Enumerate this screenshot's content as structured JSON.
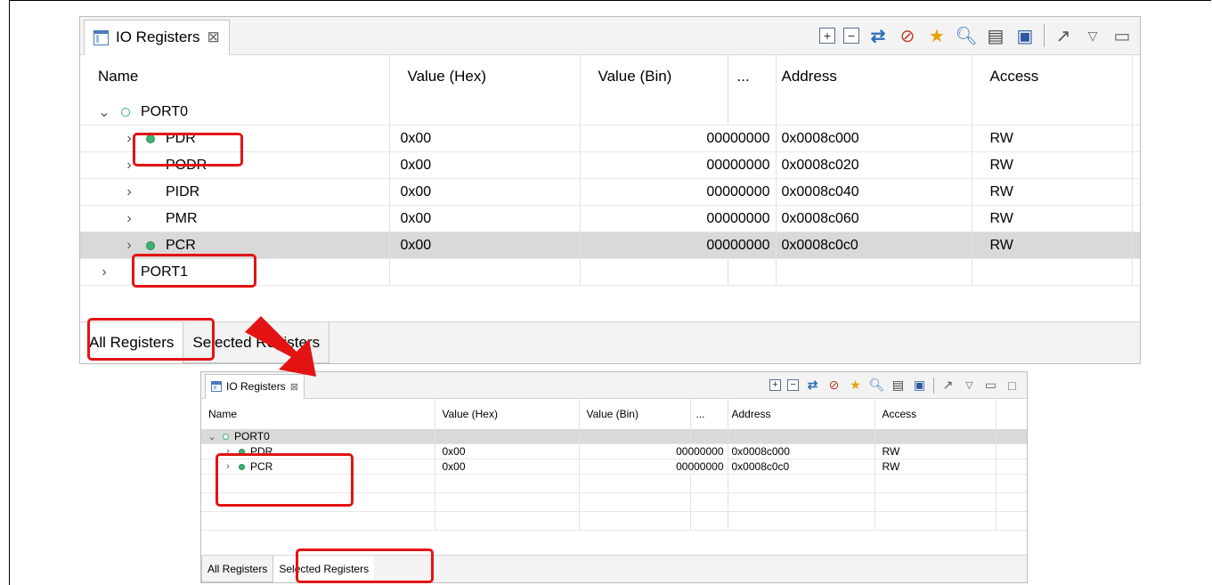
{
  "colors": {
    "highlight": "#e31313",
    "accent_green": "#3cb371",
    "selected_row": "#d9d9d9"
  },
  "large_view": {
    "tab_label": "IO Registers",
    "tab_close_icon": "close-icon",
    "toolbar_icons": [
      "expand-all-icon",
      "collapse-all-icon",
      "refresh-icon",
      "remove-icon",
      "favorite-icon",
      "search-icon",
      "print-icon",
      "save-icon",
      "open-external-icon",
      "view-menu-icon",
      "minimize-icon"
    ],
    "columns": [
      "Name",
      "Value (Hex)",
      "Value (Bin)",
      "...",
      "Address",
      "Access"
    ],
    "group": "PORT0",
    "rows": [
      {
        "name": "PDR",
        "hex": "0x00",
        "bin": "00000000",
        "addr": "0x0008c000",
        "access": "RW",
        "dot": true
      },
      {
        "name": "PODR",
        "hex": "0x00",
        "bin": "00000000",
        "addr": "0x0008c020",
        "access": "RW",
        "dot": false
      },
      {
        "name": "PIDR",
        "hex": "0x00",
        "bin": "00000000",
        "addr": "0x0008c040",
        "access": "RW",
        "dot": false
      },
      {
        "name": "PMR",
        "hex": "0x00",
        "bin": "00000000",
        "addr": "0x0008c060",
        "access": "RW",
        "dot": false
      },
      {
        "name": "PCR",
        "hex": "0x00",
        "bin": "00000000",
        "addr": "0x0008c0c0",
        "access": "RW",
        "dot": true
      }
    ],
    "group2": "PORT1",
    "bottom_tabs": [
      "All Registers",
      "Selected Registers"
    ]
  },
  "small_view": {
    "tab_label": "IO Registers",
    "columns": [
      "Name",
      "Value (Hex)",
      "Value (Bin)",
      "...",
      "Address",
      "Access"
    ],
    "group": "PORT0",
    "rows": [
      {
        "name": "PDR",
        "hex": "0x00",
        "bin": "00000000",
        "addr": "0x0008c000",
        "access": "RW"
      },
      {
        "name": "PCR",
        "hex": "0x00",
        "bin": "00000000",
        "addr": "0x0008c0c0",
        "access": "RW"
      }
    ],
    "bottom_tabs": [
      "All Registers",
      "Selected Registers"
    ]
  }
}
